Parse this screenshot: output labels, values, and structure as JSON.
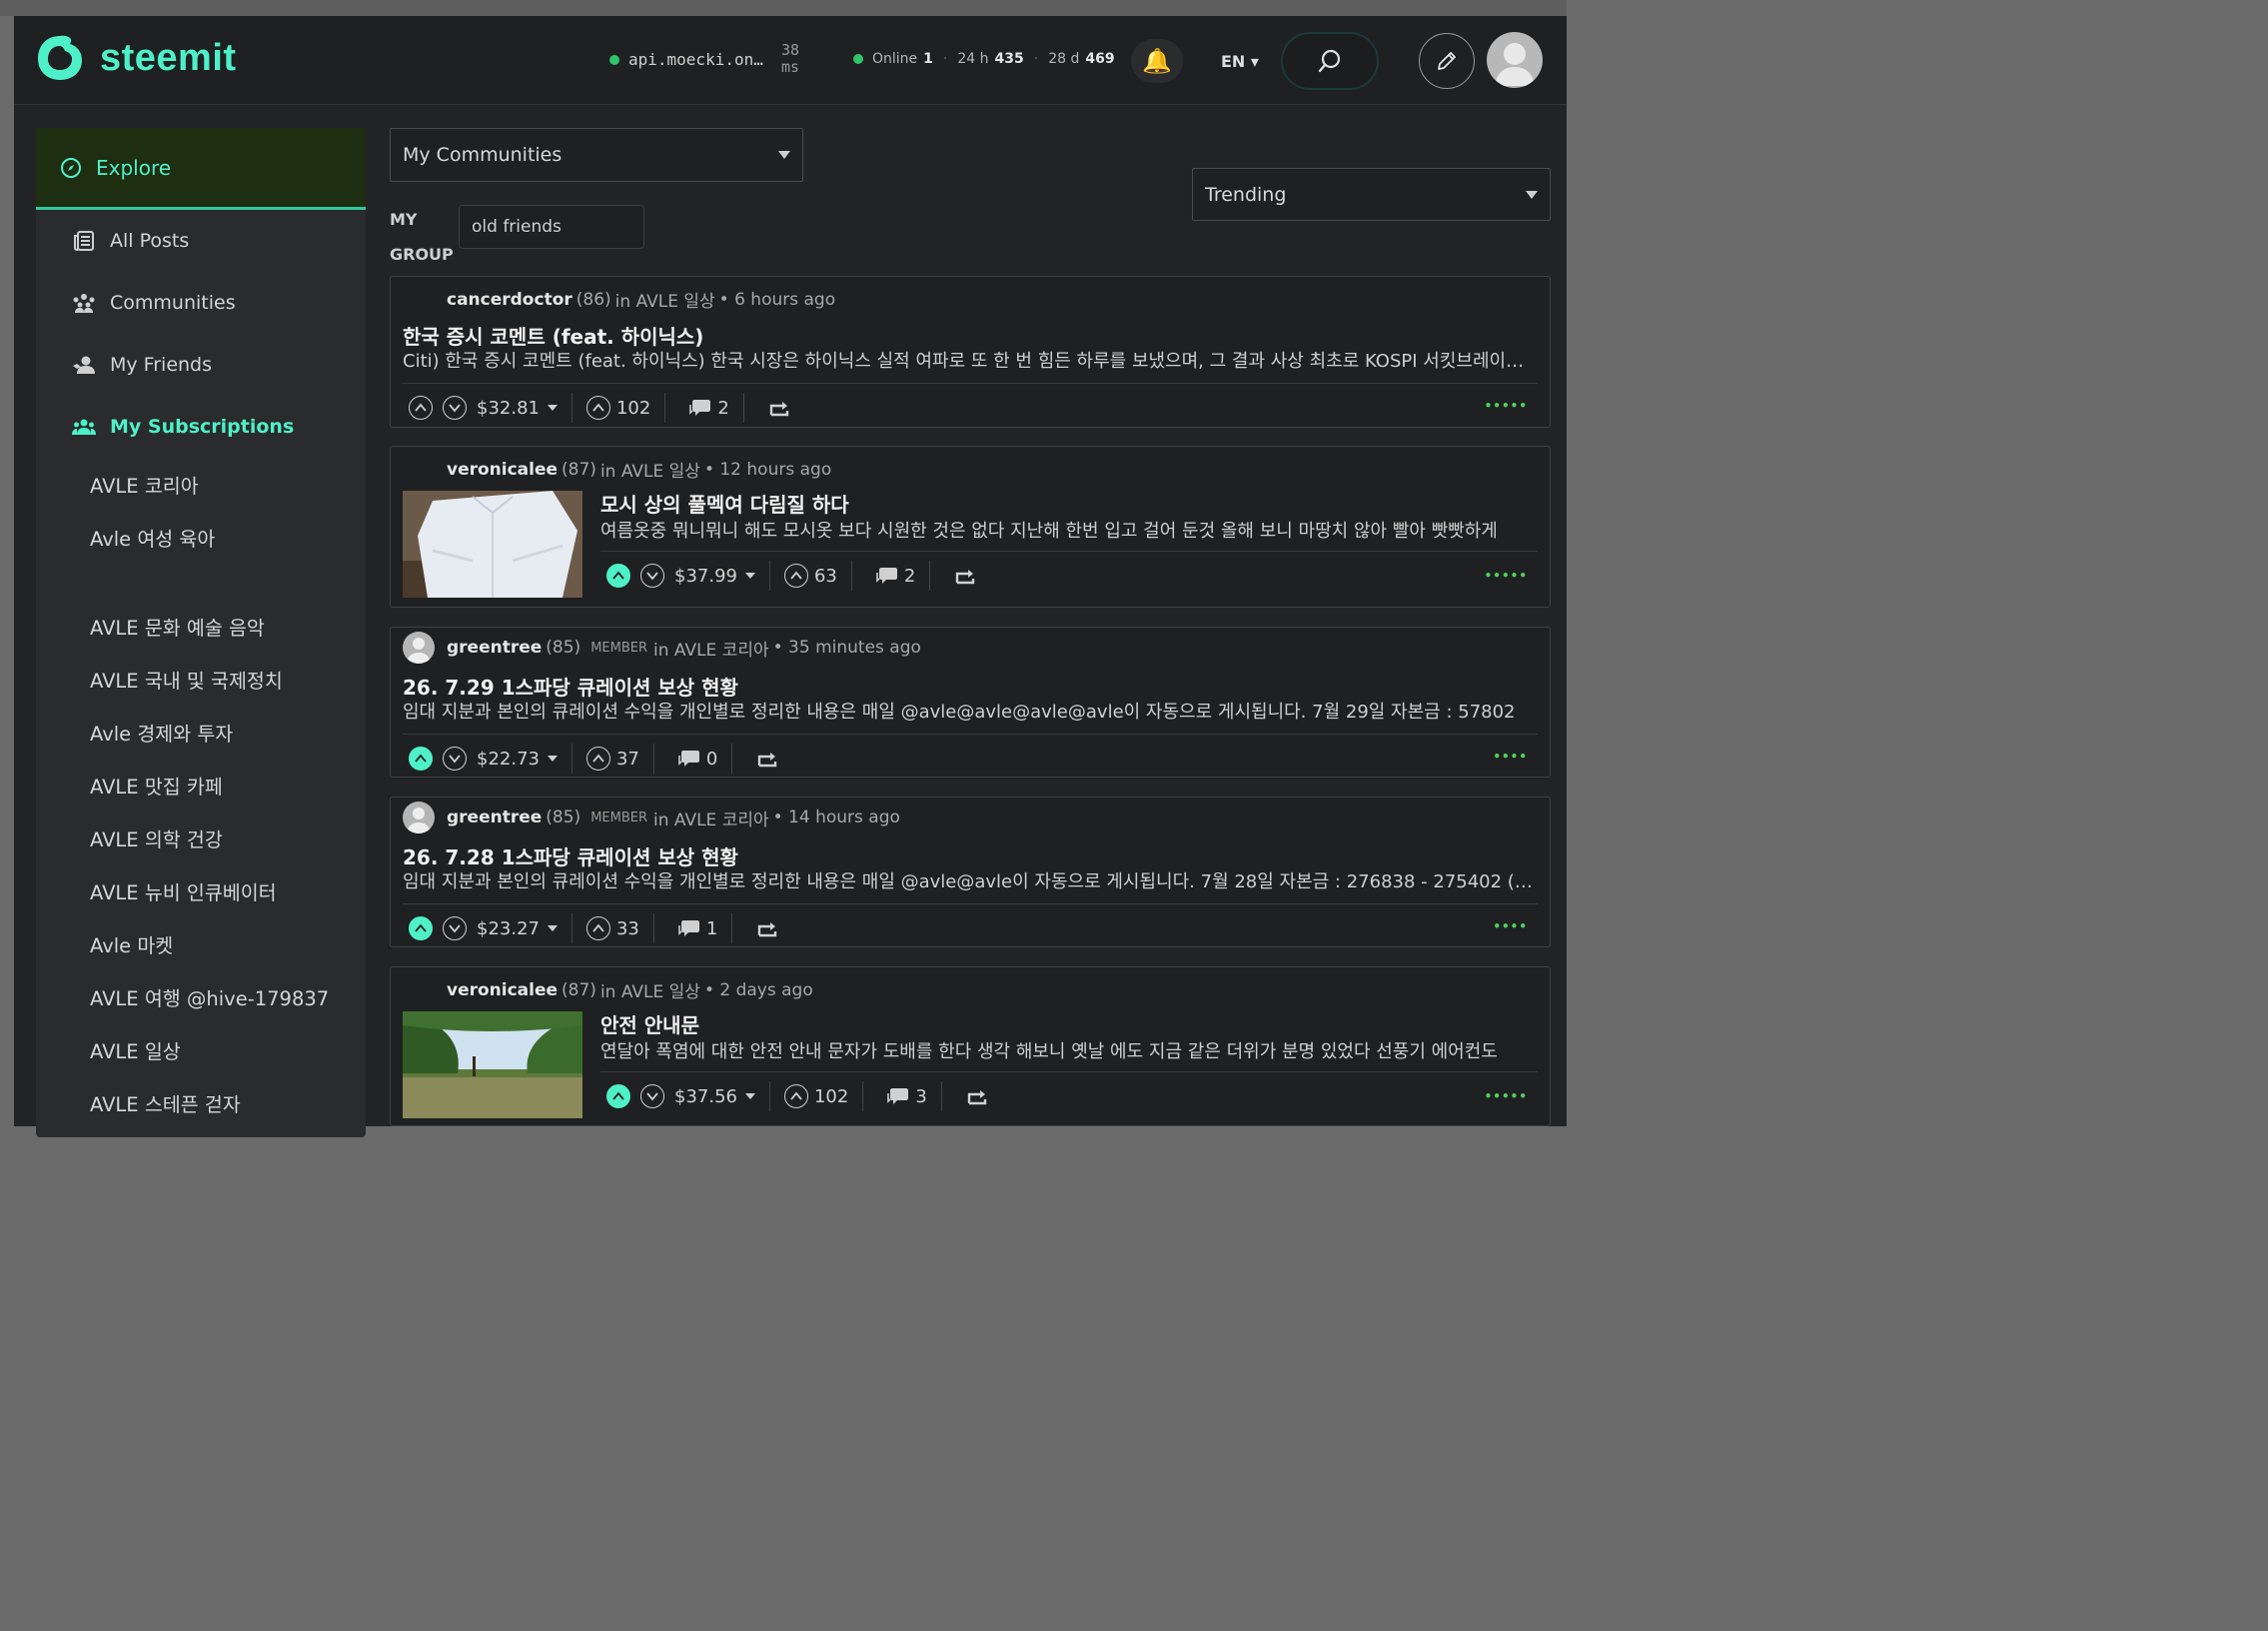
{
  "header": {
    "logo_text": "steemit",
    "api_host": "api.moecki.on…",
    "latency_value": "38",
    "latency_unit": "ms",
    "online_label": "Online",
    "online_count": "1",
    "h24_label": "24 h",
    "h24_count": "435",
    "d28_label": "28 d",
    "d28_count": "469",
    "lang": "EN ▾"
  },
  "sidebar": {
    "explore": "Explore",
    "nav": [
      {
        "label": "All Posts",
        "icon": "newspaper-icon"
      },
      {
        "label": "Communities",
        "icon": "people-group-icon"
      },
      {
        "label": "My Friends",
        "icon": "friends-icon"
      },
      {
        "label": "My Subscriptions",
        "icon": "subscriptions-icon"
      }
    ],
    "subs": [
      "AVLE 코리아",
      "Avle 여성 육아",
      "AVLE 문화 예술 음악",
      "AVLE 국내 및 국제정치",
      "Avle 경제와 투자",
      "AVLE 맛집 카페",
      "AVLE 의학 건강",
      "AVLE 뉴비 인큐베이터",
      "Avle 마켓",
      "AVLE 여행 @hive-179837",
      "AVLE 일상",
      "AVLE 스테픈 걷자"
    ]
  },
  "main": {
    "community_select": "My Communities",
    "sort_select": "Trending",
    "mygroup_label_1": "MY",
    "mygroup_label_2": "GROUP",
    "group_value": "old friends"
  },
  "posts": [
    {
      "author": "cancerdoctor",
      "rep": "(86)",
      "member": "",
      "community": "in AVLE 일상",
      "time": "• 6 hours ago",
      "title": "한국 증시 코멘트 (feat. 하이닉스)",
      "body": "Citi) 한국 증시 코멘트 (feat. 하이닉스) 한국 시장은 하이닉스 실적 여파로 또 한 번 힘든 하루를 보냈으며, 그 결과 사상 최초로 KOSPI 서킷브레이커가 발동되었습니다",
      "payout": "$32.81",
      "votes": "102",
      "comments": "2",
      "voted": false
    },
    {
      "author": "veronicalee",
      "rep": "(87)",
      "member": "",
      "community": "in AVLE 일상",
      "time": "• 12 hours ago",
      "title": "모시 상의 풀멕여 다림질 하다",
      "body": "여름옷중 뭐니뭐니 해도 모시옷 보다 시원한 것은 없다 지난해 한번 입고 걸어 둔것 올해 보니 마땅치 않아 빨아 빳빳하게",
      "payout": "$37.99",
      "votes": "63",
      "comments": "2",
      "voted": true
    },
    {
      "author": "greentree",
      "rep": "(85)",
      "member": "MEMBER",
      "community": "in AVLE 코리아",
      "time": "• 35 minutes ago",
      "title": "26. 7.29 1스파당 큐레이션 보상 현황",
      "body": "임대 지분과 본인의 큐레이션 수익을 개인별로 정리한 내용은 매일 @avle@avle@avle@avle이 자동으로 게시됩니다. 7월 29일 자본금 : 57802",
      "payout": "$22.73",
      "votes": "37",
      "comments": "0",
      "voted": true
    },
    {
      "author": "greentree",
      "rep": "(85)",
      "member": "MEMBER",
      "community": "in AVLE 코리아",
      "time": "• 14 hours ago",
      "title": "26. 7.28 1스파당 큐레이션 보상 현황",
      "body": "임대 지분과 본인의 큐레이션 수익을 개인별로 정리한 내용은 매일 @avle@avle이 자동으로 게시됩니다. 7월 28일 자본금 : 276838 - 275402 (…",
      "payout": "$23.27",
      "votes": "33",
      "comments": "1",
      "voted": true
    },
    {
      "author": "veronicalee",
      "rep": "(87)",
      "member": "",
      "community": "in AVLE 일상",
      "time": "• 2 days ago",
      "title": "안전 안내문",
      "body": "연달아 폭염에 대한 안전 안내 문자가 도배를 한다 생각 해보니 옛날 에도 지금 같은 더위가 분명 있었다 선풍기 에어컨도",
      "payout": "$37.56",
      "votes": "102",
      "comments": "3",
      "voted": true
    }
  ]
}
